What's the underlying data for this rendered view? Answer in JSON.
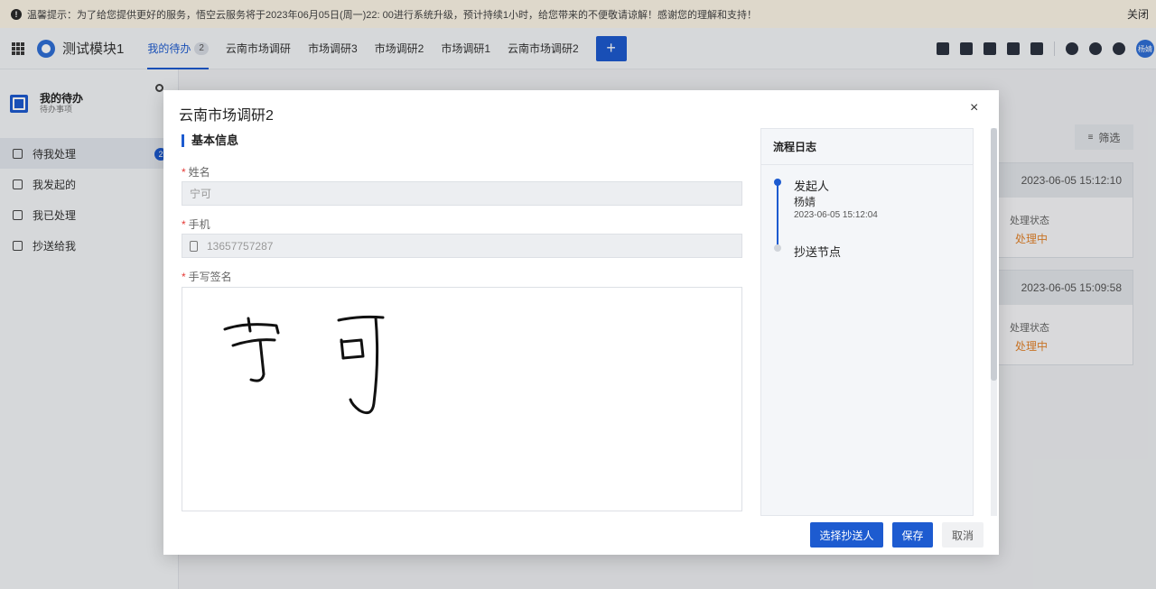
{
  "notice": {
    "icon": "info-icon",
    "text": "温馨提示：为了给您提供更好的服务，悟空云服务将于2023年06月05日(周一)22: 00进行系统升级，预计持续1小时，给您带来的不便敬请谅解！感谢您的理解和支持！",
    "close_label": "关闭"
  },
  "header": {
    "module_title": "测试模块1",
    "tabs": [
      {
        "label": "我的待办",
        "count": "2"
      },
      {
        "label": "云南市场调研"
      },
      {
        "label": "市场调研3"
      },
      {
        "label": "市场调研2"
      },
      {
        "label": "市场调研1"
      },
      {
        "label": "云南市场调研2"
      }
    ],
    "add_label": "+",
    "avatar_text": "杨婧"
  },
  "sidebar": {
    "title": "我的待办",
    "subtitle": "待办事项",
    "items": [
      {
        "label": "待我处理",
        "badge": "2"
      },
      {
        "label": "我发起的"
      },
      {
        "label": "我已处理"
      },
      {
        "label": "抄送给我"
      }
    ]
  },
  "background": {
    "filter_label": "筛选",
    "cards": [
      {
        "time": "2023-06-05 15:12:10",
        "status_label": "处理状态",
        "status_value": "处理中"
      },
      {
        "time": "2023-06-05 15:09:58",
        "status_label": "处理状态",
        "status_value": "处理中"
      }
    ]
  },
  "modal": {
    "title": "云南市场调研2",
    "close": "×",
    "section_title": "基本信息",
    "fields": {
      "name_label": "姓名",
      "name_value": "宁可",
      "phone_label": "手机",
      "phone_value": "13657757287",
      "signature_label": "手写签名",
      "required_mark": "*"
    },
    "log": {
      "title": "流程日志",
      "entries": [
        {
          "title": "发起人",
          "person": "杨婧",
          "time": "2023-06-05 15:12:04"
        },
        {
          "title": "抄送节点"
        }
      ]
    },
    "buttons": {
      "select_cc": "选择抄送人",
      "save": "保存",
      "cancel": "取消"
    }
  },
  "colors": {
    "primary": "#1d5bd0",
    "status_orange": "#e3832c",
    "notice_bg": "#fdf6e8"
  }
}
